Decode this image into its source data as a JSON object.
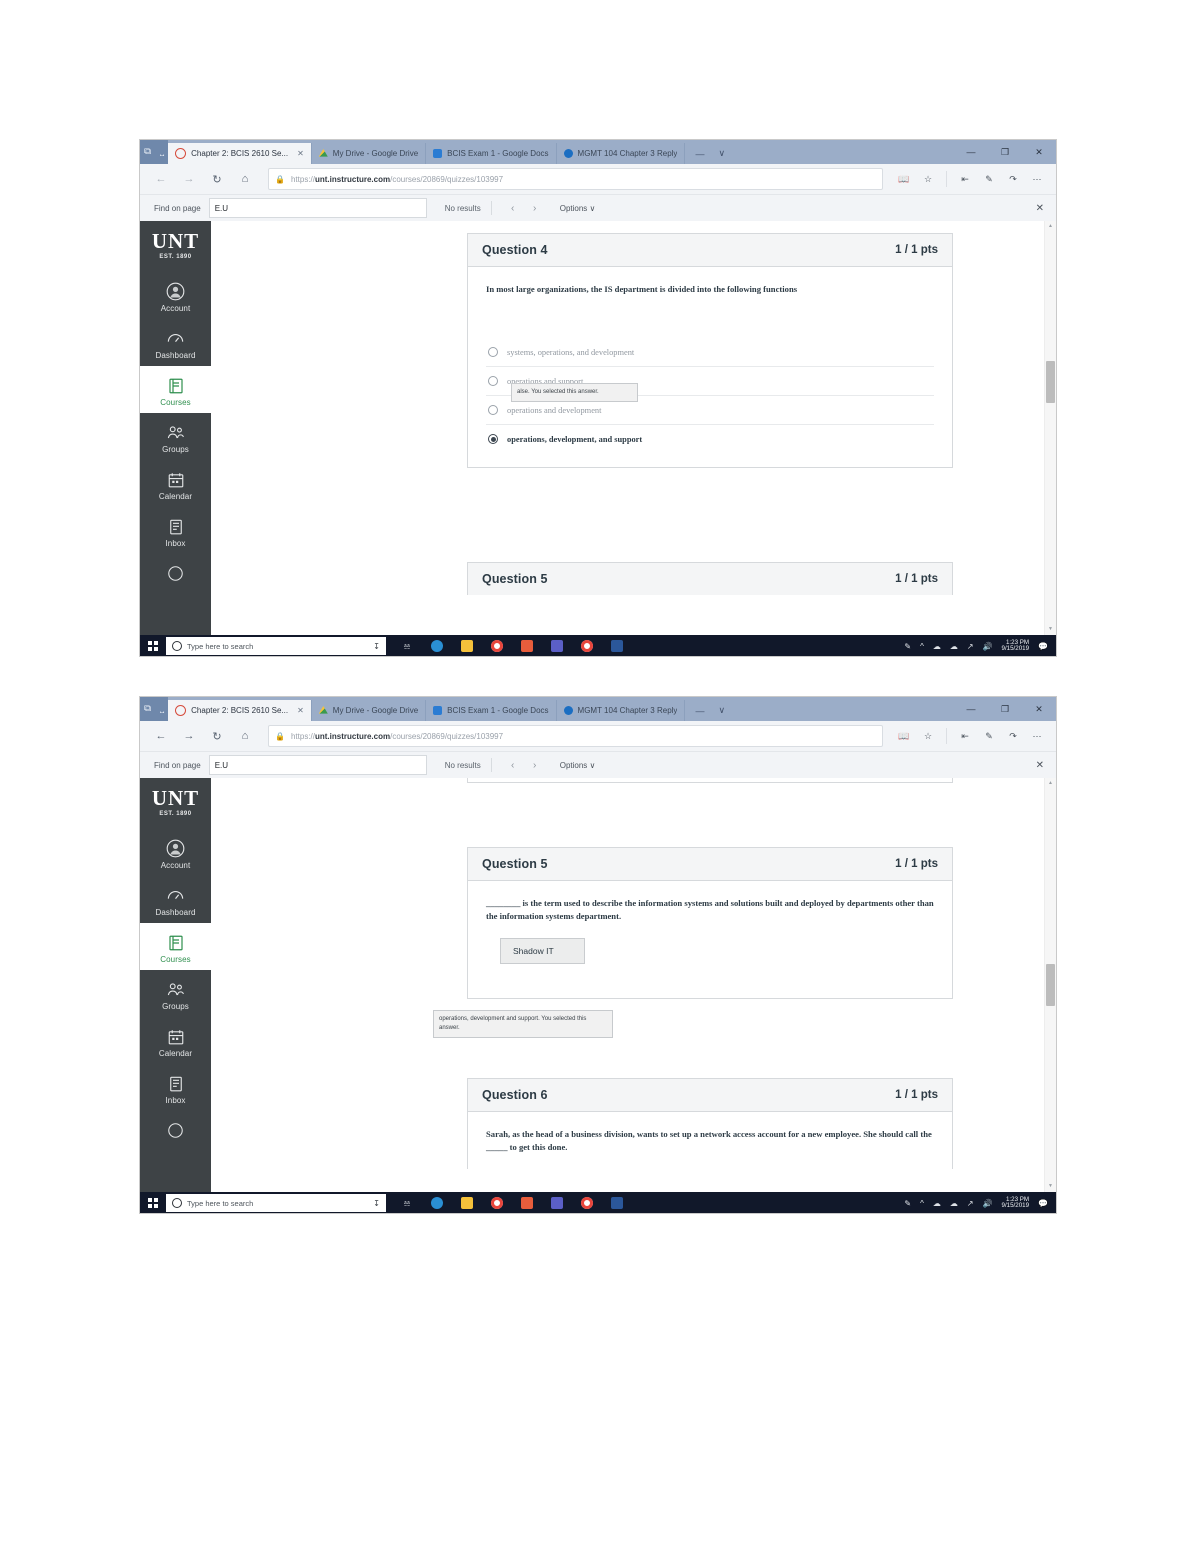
{
  "browser": {
    "tabs": [
      {
        "title": "Chapter 2: BCIS 2610 Se...",
        "icon": "canvas-ring-icon",
        "active": true
      },
      {
        "title": "My Drive - Google Drive",
        "icon": "google-drive-icon",
        "active": false
      },
      {
        "title": "BCIS Exam 1 - Google Docs",
        "icon": "google-docs-icon",
        "active": false
      },
      {
        "title": "MGMT 104 Chapter 3 Reply",
        "icon": "quiz-icon",
        "active": false
      }
    ],
    "tab_extra": [
      "—",
      "∨"
    ],
    "window_controls": [
      "—",
      "❐",
      "✕"
    ],
    "nav": {
      "back": "←",
      "forward": "→",
      "refresh": "↻",
      "home": "⌂"
    },
    "address": {
      "lock_icon": "lock-icon",
      "url_prefix": "https://",
      "url_domain": "unt.instructure.com",
      "url_path": "/courses/20869/quizzes/103997"
    },
    "address_icons": [
      "reading-view-icon",
      "favorite-star-icon",
      "favorites-hub-icon",
      "notes-icon",
      "share-icon",
      "more-settings-icon"
    ],
    "find": {
      "label": "Find on page",
      "value": "E.U",
      "placeholder": "",
      "results": "No results",
      "prev": "‹",
      "next": "›",
      "options": "Options",
      "options_caret": "∨",
      "close": "✕"
    }
  },
  "lms_nav": {
    "logo": "UNT",
    "logo_sub": "EST. 1890",
    "items": [
      {
        "label": "Account",
        "icon": "account-avatar-icon",
        "selected": false
      },
      {
        "label": "Dashboard",
        "icon": "dashboard-icon",
        "selected": false
      },
      {
        "label": "Courses",
        "icon": "courses-book-icon",
        "selected": true
      },
      {
        "label": "Groups",
        "icon": "groups-people-icon",
        "selected": false
      },
      {
        "label": "Calendar",
        "icon": "calendar-icon",
        "selected": false
      },
      {
        "label": "Inbox",
        "icon": "inbox-icon",
        "selected": false
      },
      {
        "label": "",
        "icon": "help-circle-icon",
        "selected": false
      }
    ]
  },
  "screen_one": {
    "question4": {
      "title": "Question 4",
      "points": "1 / 1 pts",
      "prompt": "In most large organizations, the IS department is divided into the following functions",
      "answers": [
        {
          "text": "systems, operations, and development",
          "selected": false
        },
        {
          "text": "operations and support",
          "selected": false
        },
        {
          "text": "operations and development",
          "selected": false
        },
        {
          "text": "operations, development, and support",
          "selected": true
        }
      ],
      "tooltip": "alse. You selected this answer."
    },
    "question5": {
      "title": "Question 5",
      "points": "1 / 1 pts"
    }
  },
  "screen_two": {
    "question5": {
      "title": "Question 5",
      "points": "1 / 1 pts",
      "prompt": "________ is the term used to describe the information systems and solutions built and deployed by departments other than the information systems department.",
      "answer_value": "Shadow IT",
      "tooltip": "operations, development and support. You selected this answer."
    },
    "question6": {
      "title": "Question 6",
      "points": "1 / 1 pts",
      "prompt": "Sarah, as the head of a business division, wants to set up a network access account for a new employee. She should call the _____ to get this done."
    }
  },
  "taskbar": {
    "start_icon": "windows-start-icon",
    "search_placeholder": "Type here to search",
    "mic_icon": "microphone-icon",
    "task_view_icon": "task-view-icon",
    "apps": [
      {
        "name": "edge-icon",
        "color": "#2a8fd4",
        "active": true
      },
      {
        "name": "file-explorer-icon",
        "color": "#f5c13b",
        "active": false
      },
      {
        "name": "chrome-icon",
        "color": "#e8453c",
        "active": false
      },
      {
        "name": "notes-app-icon",
        "color": "#e85d3c",
        "active": false
      },
      {
        "name": "teams-icon",
        "color": "#5b5fc7",
        "active": false
      },
      {
        "name": "chrome-icon-2",
        "color": "#e8453c",
        "active": false
      },
      {
        "name": "word-icon",
        "color": "#2b579a",
        "active": false
      }
    ],
    "tray": [
      "pen-icon",
      "show-hidden-icons-icon",
      "onedrive-icon",
      "cloud-icon",
      "network-icon",
      "volume-icon"
    ],
    "clock_time": "1:23 PM",
    "clock_date": "9/15/2019",
    "action_center_icon": "action-center-icon"
  },
  "colors": {
    "canvas_nav_bg": "#3e4346",
    "selected_green": "#2f8f4e",
    "taskbar_bg": "#11182a",
    "title_bar": "#9badc8",
    "heading_text": "#2d3b45"
  }
}
